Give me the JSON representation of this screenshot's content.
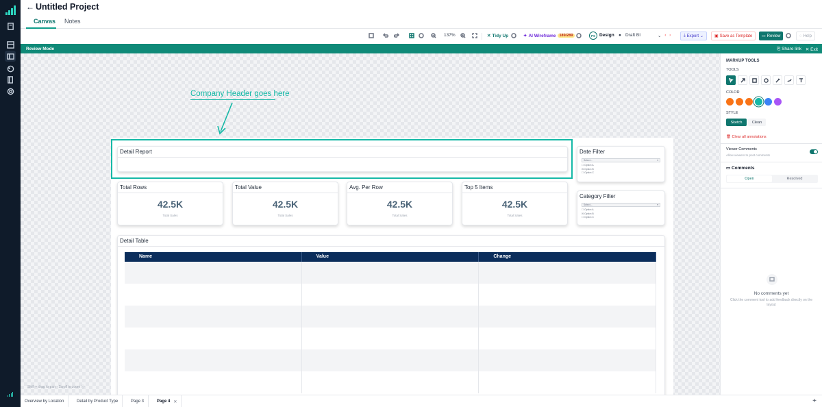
{
  "app": {
    "title": "Untitled Project",
    "tabs": [
      {
        "label": "Canvas"
      },
      {
        "label": "Notes"
      }
    ]
  },
  "toolbar": {
    "zoom": "137%",
    "tidy_up": "Tidy Up",
    "ai_wireframe": "AI Wireframe",
    "ai_count": "189/289",
    "design_badge": "PS",
    "design": "Design",
    "draft": "Draft BI",
    "export": "Export",
    "save_template": "Save as Template",
    "review": "Review",
    "help": "Help"
  },
  "review_bar": {
    "label": "Review Mode",
    "share": "Share link",
    "exit": "Exit"
  },
  "canvas": {
    "annotation_text": "Company Header goes here",
    "hint": "Shift + drag to pan · Scroll to zoom",
    "detail_report_title": "Detail Report",
    "kpis": [
      {
        "title": "Total Rows",
        "value": "42.5K",
        "sub": "Total Sales"
      },
      {
        "title": "Total Value",
        "value": "42.5K",
        "sub": "Total Sales"
      },
      {
        "title": "Avg. Per Row",
        "value": "42.5K",
        "sub": "Total Sales"
      },
      {
        "title": "Top 5 Items",
        "value": "42.5K",
        "sub": "Total Sales"
      }
    ],
    "date_filter": {
      "title": "Date Filter",
      "select": "Select...",
      "options": [
        "Option A",
        "Option B",
        "Option C"
      ]
    },
    "category_filter": {
      "title": "Category Filter",
      "select": "Select...",
      "options": [
        "Option A",
        "Option B",
        "Option C"
      ]
    },
    "detail_table": {
      "title": "Detail Table",
      "columns": [
        "Name",
        "Value",
        "Change"
      ]
    }
  },
  "markup_panel": {
    "title": "MARKUP TOOLS",
    "tools_label": "TOOLS",
    "color_label": "COLOR",
    "colors": [
      "#f97316",
      "#f97316",
      "#f97316",
      "#14b8a6",
      "#3b82f6",
      "#a855f7"
    ],
    "style_label": "STYLE",
    "style_sketch": "Sketch",
    "style_clean": "Clean",
    "clear_all": "Clear all annotations",
    "viewer_comments": "Viewer Comments",
    "viewer_comments_sub": "Allow viewers to post comments",
    "comments_title": "Comments",
    "comments_open": "Open",
    "comments_resolved": "Resolved",
    "no_comments": "No comments yet",
    "no_comments_sub": "Click the comment tool to add feedback directly on the layout"
  },
  "pages": [
    {
      "label": "Overview by Location"
    },
    {
      "label": "Detail by Product Type"
    },
    {
      "label": "Page 3"
    },
    {
      "label": "Page 4"
    }
  ]
}
